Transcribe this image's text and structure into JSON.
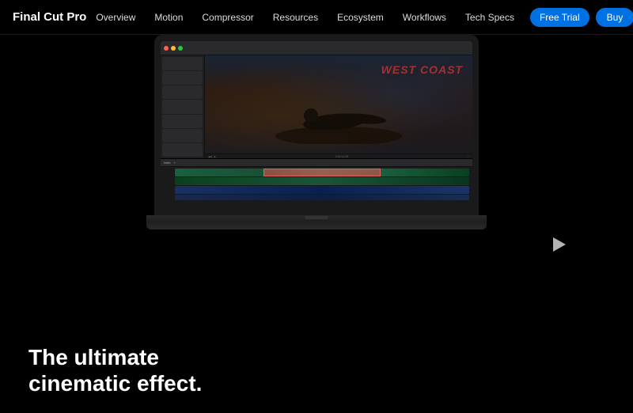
{
  "nav": {
    "logo": "Final Cut Pro",
    "links": [
      {
        "id": "overview",
        "label": "Overview"
      },
      {
        "id": "motion",
        "label": "Motion"
      },
      {
        "id": "compressor",
        "label": "Compressor"
      },
      {
        "id": "resources",
        "label": "Resources"
      },
      {
        "id": "ecosystem",
        "label": "Ecosystem"
      },
      {
        "id": "workflows",
        "label": "Workflows"
      },
      {
        "id": "tech-specs",
        "label": "Tech Specs"
      }
    ],
    "cta_trial": "Free Trial",
    "cta_buy": "Buy"
  },
  "fcp_ui": {
    "preview_title": "WEST COAST",
    "timeline_time": "1:00:14:25"
  },
  "hero": {
    "headline_line1": "The ultimate",
    "headline_line2": "cinematic effect."
  }
}
